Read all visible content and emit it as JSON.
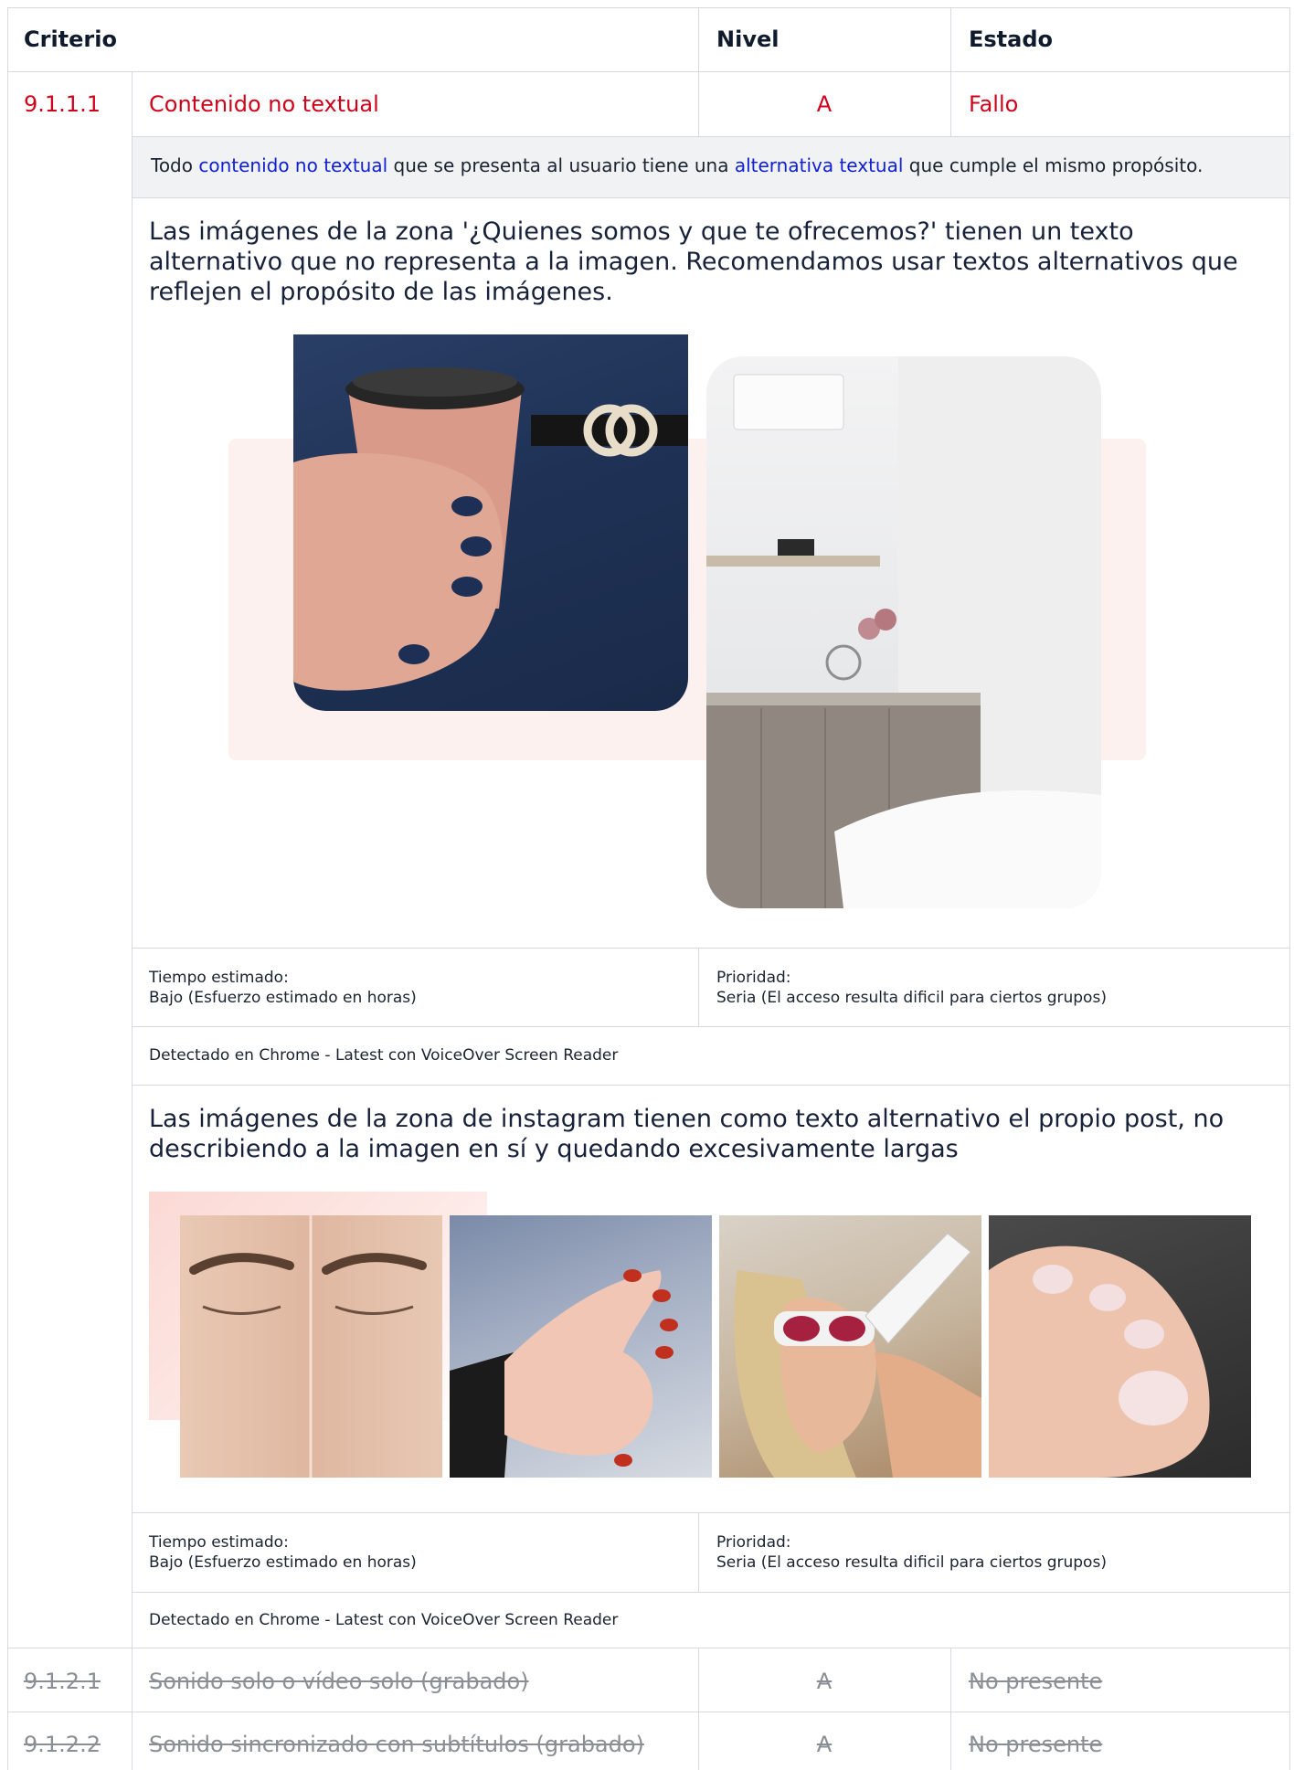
{
  "table": {
    "headers": {
      "criterio": "Criterio",
      "nivel": "Nivel",
      "estado": "Estado"
    },
    "main_row": {
      "code": "9.1.1.1",
      "name": "Contenido no textual",
      "level": "A",
      "status": "Fallo"
    },
    "description": {
      "before": "Todo ",
      "link1": "contenido no textual",
      "middle": " que se presenta al usuario tiene una ",
      "link2": "alternativa textual",
      "after": " que cumple el mismo propósito."
    },
    "findings": [
      {
        "text": "Las imágenes de la zona '¿Quienes somos y que te ofrecemos?' tienen un texto alternativo que no representa a la imagen. Recomendamos usar textos alternativos que reflejen el propósito de las imágenes.",
        "time_label": "Tiempo estimado:",
        "time_value": "Bajo (Esfuerzo estimado en horas)",
        "priority_label": "Prioridad:",
        "priority_value": "Seria (El acceso resulta dificil para ciertos grupos)",
        "detected": "Detectado en Chrome - Latest con VoiceOver Screen Reader"
      },
      {
        "text": "Las imágenes de la zona de instagram tienen como texto alternativo el propio post, no describiendo a la imagen en sí y quedando excesivamente largas",
        "time_label": "Tiempo estimado:",
        "time_value": "Bajo (Esfuerzo estimado en horas)",
        "priority_label": "Prioridad:",
        "priority_value": "Seria (El acceso resulta dificil para ciertos grupos)",
        "detected": "Detectado en Chrome - Latest con VoiceOver Screen Reader"
      }
    ],
    "other_rows": [
      {
        "code": "9.1.2.1",
        "name": "Sonido solo o vídeo solo (grabado)",
        "level": "A",
        "status": "No presente"
      },
      {
        "code": "9.1.2.2",
        "name": "Sonido sincronizado con subtítulos (grabado)",
        "level": "A",
        "status": "No presente"
      }
    ]
  },
  "colors": {
    "fail": "#d0021b",
    "link": "#1020d6",
    "border": "#d6d9dd",
    "band": "#f1f2f3"
  }
}
